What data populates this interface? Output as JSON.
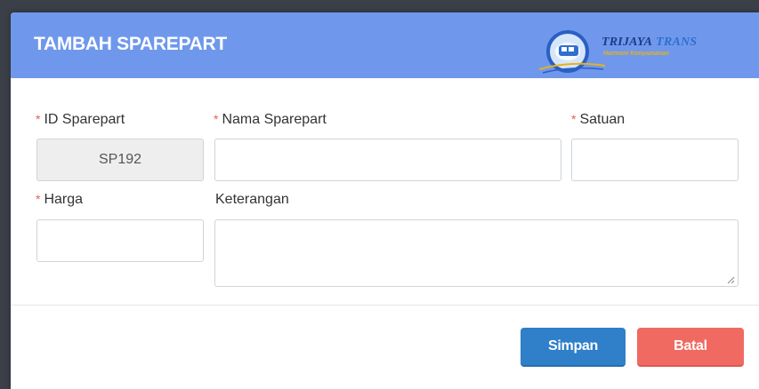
{
  "dialog": {
    "title": "TAMBAH SPAREPART",
    "logo": {
      "name_part1": "TRIJAYA",
      "name_part2": "TRANS",
      "tagline": "Harmoni Kenyamanan"
    }
  },
  "form": {
    "id_sparepart": {
      "label": "ID Sparepart",
      "value": "SP192",
      "required_mark": "*"
    },
    "nama_sparepart": {
      "label": "Nama Sparepart",
      "value": "",
      "required_mark": "*"
    },
    "satuan": {
      "label": "Satuan",
      "value": "",
      "required_mark": "*"
    },
    "harga": {
      "label": "Harga",
      "value": "",
      "required_mark": "*"
    },
    "keterangan": {
      "label": "Keterangan",
      "value": ""
    }
  },
  "buttons": {
    "save_label": "Simpan",
    "cancel_label": "Batal"
  },
  "colors": {
    "header": "#6f98ec",
    "save": "#2f7fc9",
    "cancel": "#f06a62",
    "required": "#e8604f"
  }
}
